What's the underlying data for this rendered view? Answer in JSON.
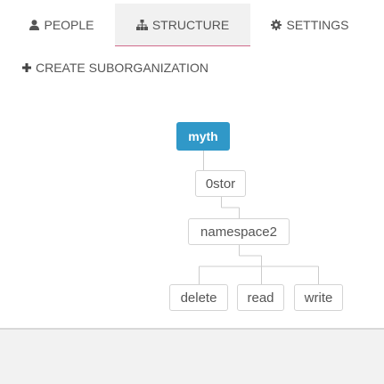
{
  "tabs": {
    "people": {
      "label": "PEOPLE",
      "icon": "user-icon"
    },
    "structure": {
      "label": "STRUCTURE",
      "icon": "sitemap-icon"
    },
    "settings": {
      "label": "SETTINGS",
      "icon": "gear-icon"
    }
  },
  "actions": {
    "create_suborganization": {
      "label": "CREATE SUBORGANIZATION",
      "icon": "plus-icon"
    }
  },
  "tree": {
    "root": "myth",
    "child": "0stor",
    "grandchild": "namespace2",
    "leaves": [
      "delete",
      "read",
      "write"
    ]
  },
  "colors": {
    "root_node": "#3098c8",
    "active_tab_background": "#f1f1f1",
    "active_tab_underline": "#d06a8a",
    "footer_background": "#f2f2f2"
  }
}
